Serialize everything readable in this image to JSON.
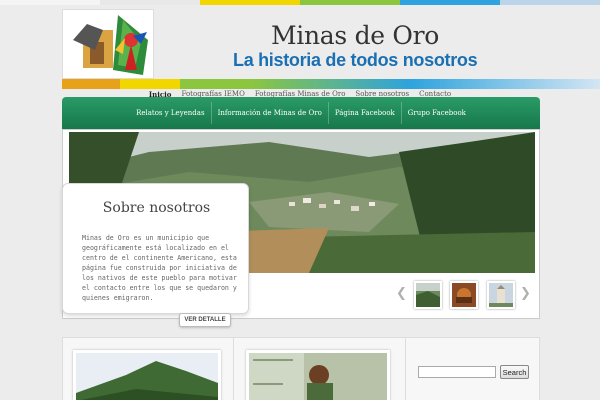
{
  "header": {
    "title": "Minas de Oro",
    "tagline": "La historia de todos nosotros"
  },
  "top_menu": {
    "items": [
      {
        "label": "Inicio",
        "active": true
      },
      {
        "label": "Fotografías IEMO",
        "active": false
      },
      {
        "label": "Fotografías Minas de Oro",
        "active": false
      },
      {
        "label": "Sobre nosotros",
        "active": false
      },
      {
        "label": "Contacto",
        "active": false
      }
    ]
  },
  "green_nav": {
    "items": [
      {
        "label": "Relatos y Leyendas",
        "active": false
      },
      {
        "label": "Información de Minas de Oro",
        "active": true
      },
      {
        "label": "Página Facebook",
        "active": false
      },
      {
        "label": "Grupo Facebook",
        "active": false
      }
    ]
  },
  "featured": {
    "title": "Sobre nosotros",
    "text": "Minas de Oro es un municipio que geográficamente está localizado en el centro de el continente Americano, esta página fue construida por iniciativa de los nativos de este pueblo para motivar el contacto entre los que se quedaron y quienes emigraron.",
    "button_label": "VER DETALLE"
  },
  "slider": {
    "prev_icon": "chevron-left-icon",
    "next_icon": "chevron-right-icon",
    "thumb_count": 3
  },
  "sidebar": {
    "search_placeholder": "",
    "search_button": "Search"
  },
  "colors": {
    "accent_green": "#1f8a57",
    "tagline_blue": "#1b6fb3",
    "stripe": [
      "#e84c3d",
      "#f39c12",
      "#f1d600",
      "#8cc63f",
      "#2ea3dd",
      "#1b6fb3"
    ]
  }
}
